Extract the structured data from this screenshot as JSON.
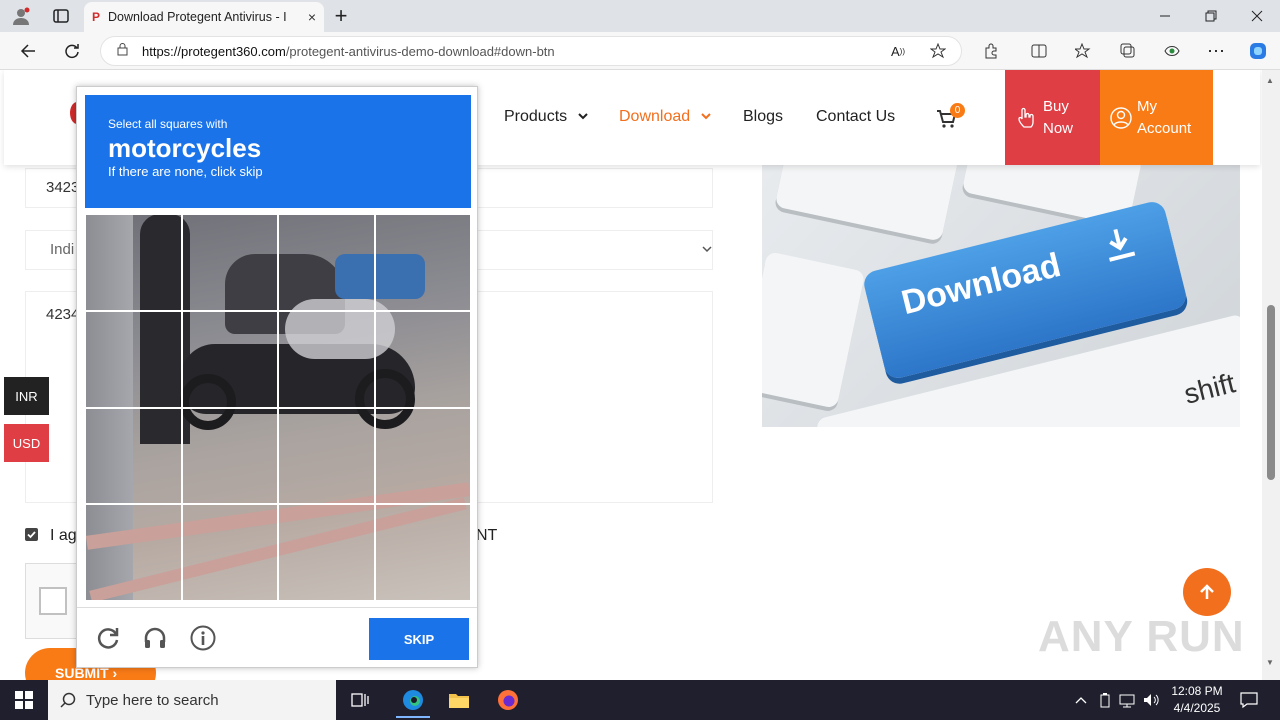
{
  "browser": {
    "tab_title": "Download Protegent Antivirus - I",
    "tab_favicon": "P",
    "url_host": "https://protegent360.com",
    "url_path": "/protegent-antivirus-demo-download#down-btn",
    "new_tab": "+",
    "close_tab": "×"
  },
  "header": {
    "nav": [
      {
        "label": "Products",
        "chevron": "⌄"
      },
      {
        "label": "Download",
        "chevron": "⌄"
      },
      {
        "label": "Blogs"
      },
      {
        "label": "Contact Us"
      }
    ],
    "cart_count": "0",
    "buy_now": [
      "Buy",
      "Now"
    ],
    "my_account": [
      "My",
      "Account"
    ]
  },
  "form": {
    "field1_value": "3423",
    "field2_value": "Indi",
    "field3_value": "4234",
    "agree_text": "I ag",
    "agree_suffix": "NT",
    "submit_label": "SUBMIT"
  },
  "currency": {
    "inr": "INR",
    "usd": "USD"
  },
  "banner": {
    "key_text": "Download",
    "shift_text": "shift"
  },
  "captcha": {
    "instruction": "Select all squares with",
    "target": "motorcycles",
    "hint": "If there are none, click skip",
    "skip_label": "SKIP"
  },
  "watermark": "ANY RUN",
  "taskbar": {
    "search_placeholder": "Type here to search",
    "time": "12:08 PM",
    "date": "4/4/2025"
  },
  "colors": {
    "accent_blue": "#1a73e8",
    "brand_orange": "#f97b16",
    "brand_red": "#e03e45",
    "inr_bg": "#222222",
    "usd_bg": "#e03e45"
  }
}
